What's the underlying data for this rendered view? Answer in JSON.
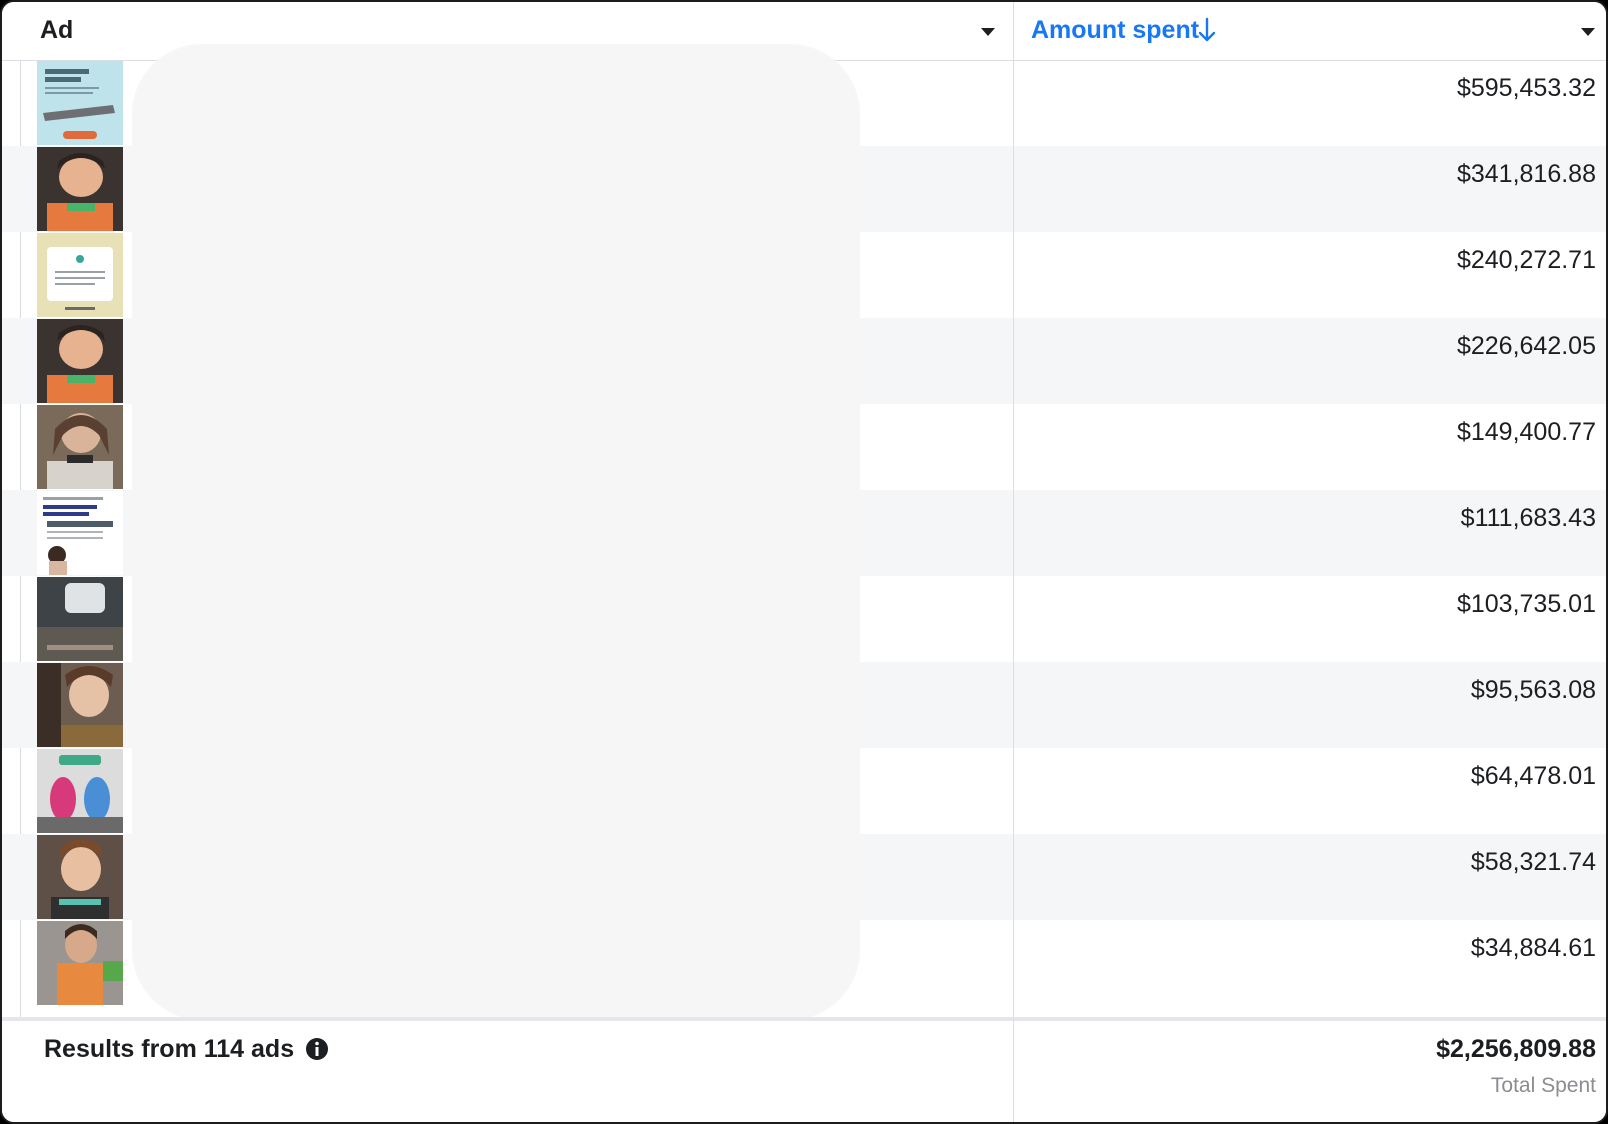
{
  "header": {
    "ad_label": "Ad",
    "amount_label": "Amount spent"
  },
  "rows": [
    {
      "amount": "$595,453.32"
    },
    {
      "amount": "$341,816.88"
    },
    {
      "amount": "$240,272.71"
    },
    {
      "amount": "$226,642.05"
    },
    {
      "amount": "$149,400.77"
    },
    {
      "amount": "$111,683.43"
    },
    {
      "amount": "$103,735.01"
    },
    {
      "amount": "$95,563.08"
    },
    {
      "amount": "$64,478.01"
    },
    {
      "amount": "$58,321.74"
    },
    {
      "amount": "$34,884.61"
    }
  ],
  "footer": {
    "results_text": "Results from 114 ads",
    "total_amount": "$2,256,809.88",
    "total_label": "Total Spent"
  },
  "colors": {
    "accent": "#1877f2",
    "text": "#1c1e21",
    "muted": "#8a8d91",
    "row_alt": "#f5f6f7"
  },
  "icons": {
    "sort": "arrow-down-icon",
    "dropdown": "caret-down-icon",
    "info": "info-icon"
  }
}
